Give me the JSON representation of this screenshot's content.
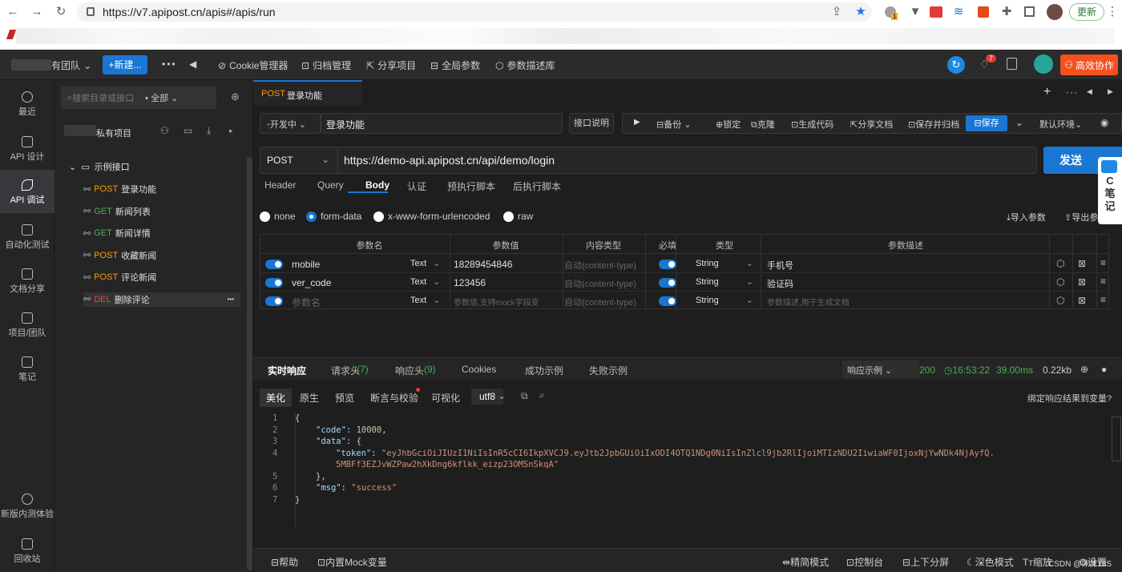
{
  "browser": {
    "url": "https://v7.apipost.cn/apis#/apis/run",
    "update_label": "更新",
    "ext_badge": "1"
  },
  "topbar": {
    "team": "有团队",
    "new_btn": "+新建...",
    "cookie": "Cookie管理器",
    "archive": "归档管理",
    "share": "分享项目",
    "global_params": "全局参数",
    "param_desc": "参数描述库",
    "notif_count": "7",
    "collab": "高效协作"
  },
  "leftnav": {
    "items": [
      "最近",
      "API 设计",
      "API 调试",
      "自动化测试",
      "文档分享",
      "项目/团队",
      "笔记"
    ],
    "bottom": [
      "新版内测体验",
      "回收站"
    ]
  },
  "tree": {
    "search_placeholder": "搜索目录或接口",
    "filter": "全部",
    "project": "私有项目",
    "folder": "示例接口",
    "items": [
      {
        "method": "POST",
        "name": "登录功能"
      },
      {
        "method": "GET",
        "name": "新闻列表"
      },
      {
        "method": "GET",
        "name": "新闻详情"
      },
      {
        "method": "POST",
        "name": "收藏新闻"
      },
      {
        "method": "POST",
        "name": "评论新闻"
      },
      {
        "method": "DEL",
        "name": "删除评论"
      }
    ],
    "more": "•••"
  },
  "tab": {
    "method": "POST",
    "title": "登录功能"
  },
  "reqbar": {
    "status": "开发中",
    "name": "登录功能",
    "doc": "接口说明",
    "backup": "备份",
    "lock": "锁定",
    "clone": "克隆",
    "gen_code": "生成代码",
    "share_doc": "分享文档",
    "save_archive": "保存并归档",
    "save": "保存",
    "env": "默认环境"
  },
  "url": {
    "method": "POST",
    "value": "https://demo-api.apipost.cn/api/demo/login",
    "send": "发送"
  },
  "side_note": "C\n笔\n记",
  "req_tabs": [
    "Header",
    "Query",
    "Body",
    "认证",
    "预执行脚本",
    "后执行脚本"
  ],
  "body_types": [
    "none",
    "form-data",
    "x-www-form-urlencoded",
    "raw"
  ],
  "body_actions": {
    "import": "导入参数",
    "export": "导出参"
  },
  "table": {
    "headers": [
      "参数名",
      "参数值",
      "内容类型",
      "必填",
      "类型",
      "参数描述"
    ],
    "rows": [
      {
        "name": "mobile",
        "ftype": "Text",
        "value": "18289454846",
        "ctype": "自动(content-type)",
        "type": "String",
        "desc": "手机号"
      },
      {
        "name": "ver_code",
        "ftype": "Text",
        "value": "123456",
        "ctype": "自动(content-type)",
        "type": "String",
        "desc": "验证码"
      },
      {
        "name": "参数名",
        "ftype": "Text",
        "value": "参数值,支持mock字段变",
        "ctype": "自动(content-type)",
        "type": "String",
        "desc": "参数描述,用于生成文档"
      }
    ]
  },
  "resp_tabs": [
    "实时响应",
    "请求头",
    "(7)",
    "响应头",
    "(9)",
    "Cookies",
    "成功示例",
    "失败示例"
  ],
  "resp_meta": {
    "example": "响应示例",
    "status": "200",
    "time": "16:53:22",
    "duration": "39.00ms",
    "size": "0.22kb"
  },
  "resp_sub": [
    "美化",
    "原生",
    "预览",
    "断言与校验",
    "可视化",
    "utf8"
  ],
  "bind_label": "绑定响应结果到变量?",
  "code_lines": [
    "1",
    "2",
    "3",
    "4",
    "",
    "5",
    "6",
    "7"
  ],
  "response": {
    "code_key": "\"code\"",
    "code_val": "10000",
    "data_key": "\"data\"",
    "token_key": "\"token\"",
    "token_val1": "\"eyJhbGciOiJIUzI1NiIsInR5cCI6IkpXVCJ9.eyJtb2JpbGUiOiIxODI4OTQ1NDg0NiIsInZlcl9jb2RlIjoiMTIzNDU2IiwiaWF0IjoxNjYwNDk4NjAyfQ.",
    "token_val2": "5MBFf3EZJvWZPaw2hXkDng6kflkk_eizp23OMSnSkqA\"",
    "msg_key": "\"msg\"",
    "msg_val": "\"success\""
  },
  "bottombar": {
    "help": "帮助",
    "mock": "内置Mock变量",
    "precise": "精简模式",
    "console": "控制台",
    "split": "上下分屏",
    "dark": "深色模式",
    "zoom": "缩放",
    "settings": "设置",
    "watermark": "CSDN @沫沫18S"
  }
}
